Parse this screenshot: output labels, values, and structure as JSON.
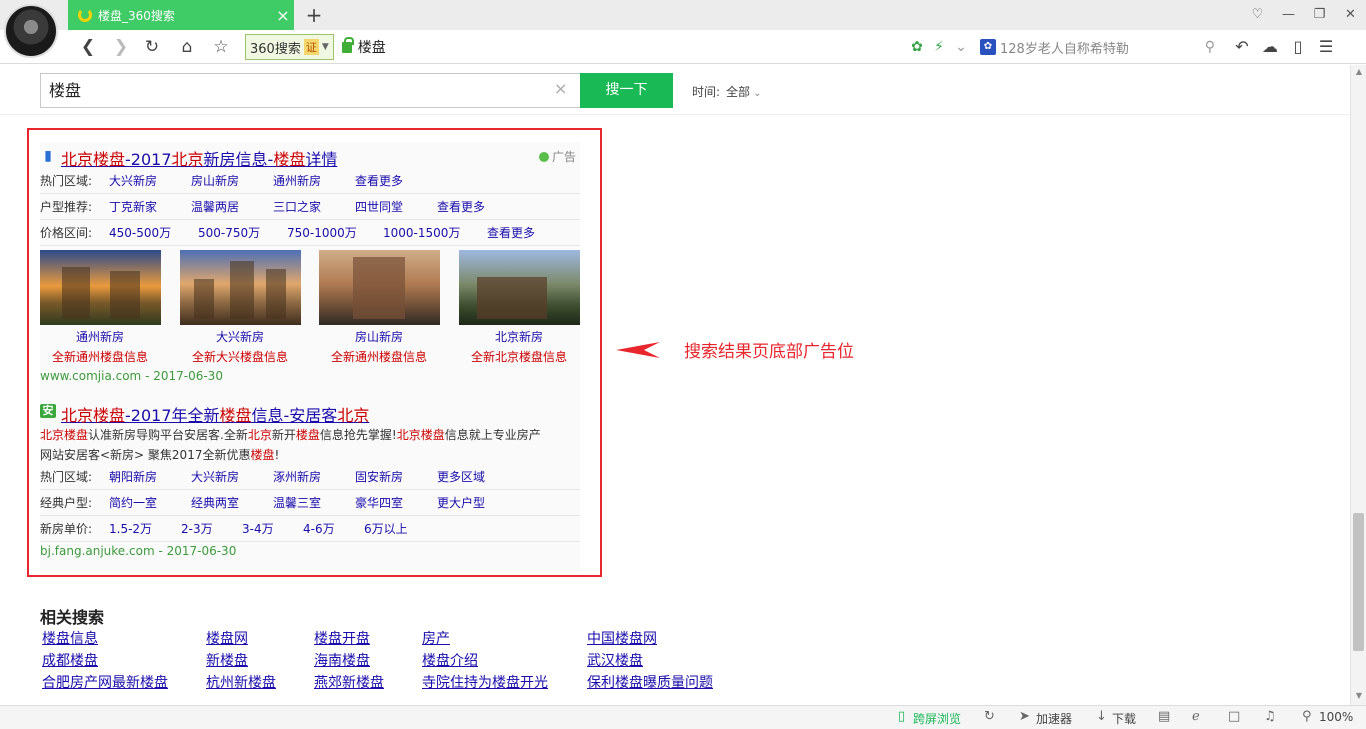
{
  "browser": {
    "tab_title": "楼盘_360搜索",
    "tab_close": "×",
    "new_tab": "+",
    "engine": "360搜索",
    "engine_badge": "证",
    "url": "楼盘",
    "side_search_query": "128岁老人自称希特勒",
    "nav_icons": [
      "back-icon",
      "forward-icon",
      "reload-icon",
      "home-icon",
      "favorite-icon"
    ],
    "window_controls": [
      "skin-icon",
      "minimize-icon",
      "restore-icon",
      "close-icon"
    ]
  },
  "search": {
    "query": "楼盘",
    "clear": "×",
    "button": "搜一下",
    "time_label": "时间:",
    "time_value": "全部"
  },
  "ad1": {
    "title_parts": [
      "北京楼盘",
      "-2017",
      "北京",
      "新房信息-",
      "楼盘",
      "详情"
    ],
    "ad_label": "广告",
    "rows": [
      {
        "label": "热门区域:",
        "links": [
          "大兴新房",
          "房山新房",
          "通州新房",
          "查看更多"
        ]
      },
      {
        "label": "户型推荐:",
        "links": [
          "丁克新家",
          "温馨两居",
          "三口之家",
          "四世同堂",
          "查看更多"
        ]
      },
      {
        "label": "价格区间:",
        "links": [
          "450-500万",
          "500-750万",
          "750-1000万",
          "1000-1500万",
          "查看更多"
        ]
      }
    ],
    "thumbs": [
      {
        "title": "通州新房",
        "sub": "全新通州楼盘信息"
      },
      {
        "title": "大兴新房",
        "sub": "全新大兴楼盘信息"
      },
      {
        "title": "房山新房",
        "sub": "全新通州楼盘信息"
      },
      {
        "title": "北京新房",
        "sub": "全新北京楼盘信息"
      }
    ],
    "url": "www.comjia.com - 2017-06-30"
  },
  "ad2": {
    "title_parts": [
      "北京楼盘",
      "-2017年全新",
      "楼盘",
      "信息-安居客",
      "北京"
    ],
    "desc_line1": [
      "北京楼盘",
      "认准新房导购平台安居客.全新",
      "北京",
      "新开",
      "楼盘",
      "信息抢先掌握!",
      "北京楼盘",
      "信息就上专业房产"
    ],
    "desc_line2": [
      "网站安居客<新房> 聚焦2017全新优惠",
      "楼盘",
      "!"
    ],
    "rows": [
      {
        "label": "热门区域:",
        "links": [
          "朝阳新房",
          "大兴新房",
          "涿州新房",
          "固安新房",
          "更多区域"
        ]
      },
      {
        "label": "经典户型:",
        "links": [
          "简约一室",
          "经典两室",
          "温馨三室",
          "豪华四室",
          "更大户型"
        ]
      },
      {
        "label": "新房单价:",
        "links": [
          "1.5-2万",
          "2-3万",
          "3-4万",
          "4-6万",
          "6万以上"
        ]
      }
    ],
    "url": "bj.fang.anjuke.com - 2017-06-30"
  },
  "annotation": "搜索结果页底部广告位",
  "related": {
    "title": "相关搜索",
    "rows": [
      [
        "楼盘信息",
        "楼盘网",
        "楼盘开盘",
        "房产",
        "中国楼盘网"
      ],
      [
        "成都楼盘",
        "新楼盘",
        "海南楼盘",
        "楼盘介绍",
        "武汉楼盘"
      ],
      [
        "合肥房产网最新楼盘",
        "杭州新楼盘",
        "燕郊新楼盘",
        "寺院住持为楼盘开光",
        "保利楼盘曝质量问题"
      ]
    ]
  },
  "statusbar": {
    "cross_screen": "跨屏浏览",
    "accelerator": "加速器",
    "download": "下载",
    "zoom": "100%"
  },
  "colors": {
    "accent_green": "#19b955",
    "tab_green": "#3fcb65",
    "link_blue": "#1a0dab",
    "highlight_red": "#cc0000",
    "annotation_red": "#e8262d",
    "url_green": "#3d9a3d"
  }
}
